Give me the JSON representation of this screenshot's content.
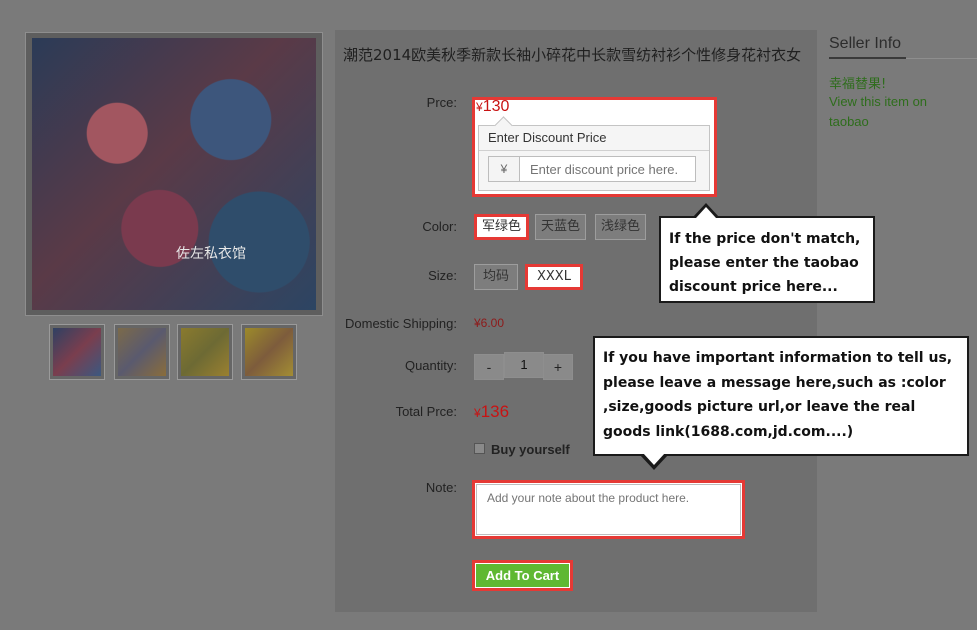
{
  "gallery": {
    "watermark_text": "佐左私衣馆",
    "thumbnails": [
      "thumb-1",
      "thumb-2",
      "thumb-3",
      "thumb-4"
    ]
  },
  "product": {
    "title": "潮范2014欧美秋季新款长袖小碎花中长款雪纺衬衫个性修身花衬衣女",
    "price_label": "Prce:",
    "price_currency": "¥",
    "price_value": "130",
    "discount": {
      "title": "Enter Discount Price",
      "currency_addon": "¥",
      "placeholder": "Enter discount price here."
    },
    "color_label": "Color:",
    "colors": [
      "军绿色",
      "天蓝色",
      "浅绿色"
    ],
    "selected_color": "军绿色",
    "size_label": "Size:",
    "sizes": [
      "均码",
      "XXXL"
    ],
    "selected_size": "XXXL",
    "shipping_label": "Domestic Shipping:",
    "shipping_value": "¥6.00",
    "quantity_label": "Quantity:",
    "quantity_minus": "-",
    "quantity_value": "1",
    "quantity_plus": "+",
    "total_label": "Total Prce:",
    "total_currency": "¥",
    "total_value": "136",
    "buy_yourself_label": "Buy yourself",
    "note_label": "Note:",
    "note_placeholder": "Add your note about the product here.",
    "add_to_cart_label": "Add To Cart"
  },
  "seller": {
    "title": "Seller Info",
    "name": "幸福替果!",
    "view_link_line1": "View this item on",
    "view_link_line2": "taobao"
  },
  "callouts": {
    "price_lines": [
      "If the price don't match,",
      "please enter the taobao",
      "discount price here..."
    ],
    "note_lines": [
      "If you have important information to tell us,",
      "please leave a message here,such as :color",
      ",size,goods picture url,or leave the real",
      "goods link(1688.com,jd.com....)"
    ]
  },
  "colors": {
    "overlay_background": "#7a7a7a",
    "highlight_red": "#e53935",
    "price_red": "#c81313",
    "cart_green": "#5fb832",
    "seller_green": "#2e6d1c"
  }
}
